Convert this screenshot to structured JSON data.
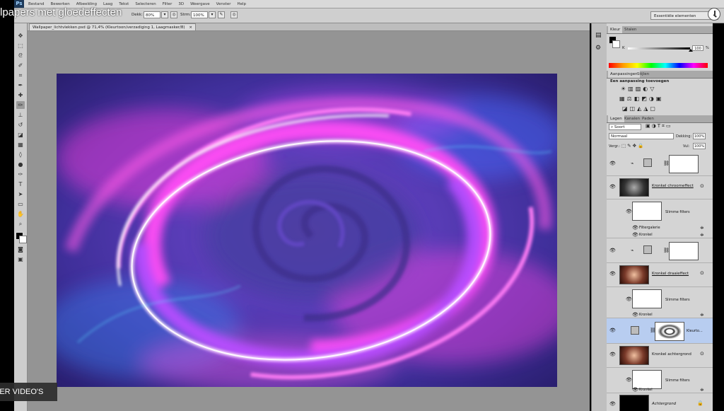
{
  "video": {
    "title": "lpapers met gloedeffecten",
    "more_videos_label": "EER VIDEO'S"
  },
  "app": {
    "logo": "Ps",
    "menu": [
      "Bestand",
      "Bewerken",
      "Afbeelding",
      "Laag",
      "Tekst",
      "Selecteren",
      "Filter",
      "3D",
      "Weergave",
      "Venster",
      "Help"
    ]
  },
  "options_bar": {
    "opacity_label": "Dekk:",
    "opacity_value": "80%",
    "flow_label": "Strm:",
    "flow_value": "100%",
    "workspace": "Essentiële elementen"
  },
  "document": {
    "tab_title": "Wallpaper_lichtvlekken.psd @ 71,4% (Kleurtoon/verzadiging 1, Laagmasker/8)",
    "close": "×"
  },
  "color_panel": {
    "tabs": [
      "Kleur",
      "Stalen"
    ],
    "channel_label": "K",
    "value": "100",
    "unit": "%"
  },
  "adjustments_panel": {
    "tabs": [
      "Aanpassingen",
      "Stijlen"
    ],
    "heading": "Een aanpassing toevoegen"
  },
  "layers_panel": {
    "tabs": [
      "Lagen",
      "Kanalen",
      "Paden"
    ],
    "filter_kind": "Soort",
    "blend_mode": "Normaal",
    "opacity_label": "Dekking:",
    "opacity_value": "100%",
    "lock_label": "Vergr.:",
    "fill_label": "Vul:",
    "fill_value": "100%",
    "layers": [
      {
        "name": "",
        "type": "adjustment"
      },
      {
        "name": "Kronkel chroomeffect",
        "type": "smart"
      },
      {
        "name": "Slimme filters",
        "type": "filtermask"
      },
      {
        "name": "Filtergalerie",
        "type": "filter"
      },
      {
        "name": "Kronkel",
        "type": "filter"
      },
      {
        "name": "",
        "type": "adjustment"
      },
      {
        "name": "Kronkel draaieffect",
        "type": "smart"
      },
      {
        "name": "Slimme filters",
        "type": "filtermask"
      },
      {
        "name": "Kronkel",
        "type": "filter"
      },
      {
        "name": "Kleurto...",
        "type": "adjustment-selected"
      },
      {
        "name": "Kronkel achtergrond",
        "type": "smart"
      },
      {
        "name": "Slimme filters",
        "type": "filtermask"
      },
      {
        "name": "Kronkel",
        "type": "filter"
      },
      {
        "name": "Achtergrond",
        "type": "background"
      }
    ]
  },
  "colors": {
    "ui_gray": "#d4d4d4",
    "selected_row": "#b8cdf0",
    "glow_magenta": "#ff4df5",
    "glow_violet": "#8a3cff"
  }
}
